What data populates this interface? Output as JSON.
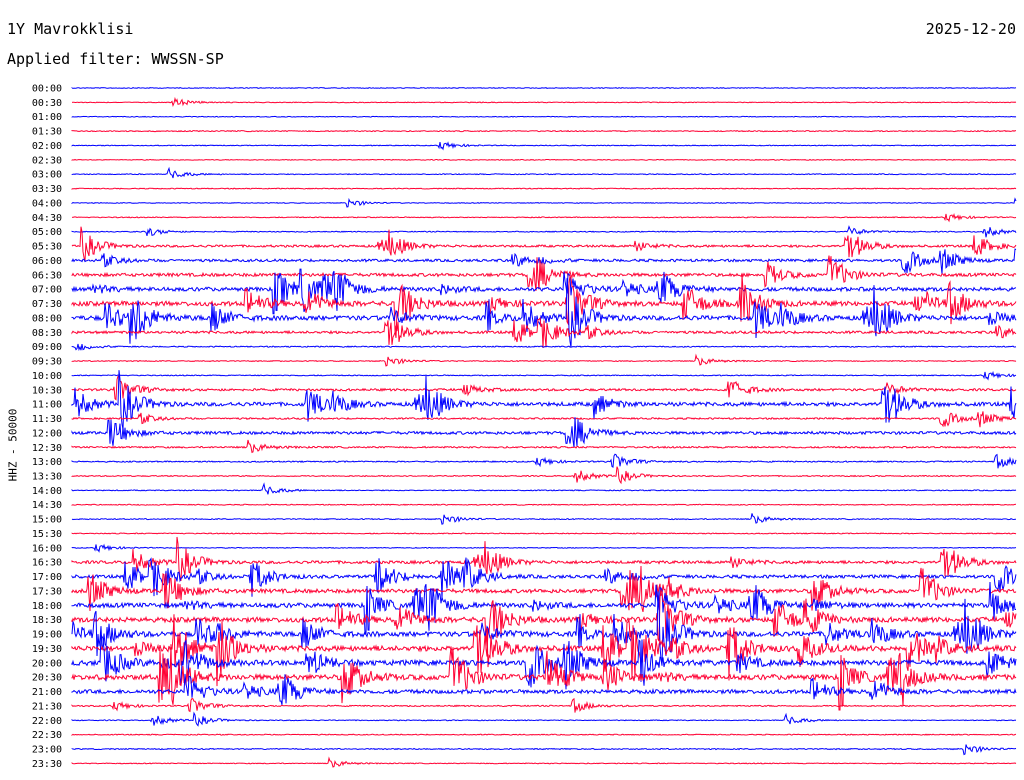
{
  "header": {
    "station": "1Y Mavrokklisi",
    "date": "2025-12-20",
    "filter": "Applied filter: WWSSN-SP"
  },
  "chart_data": {
    "type": "line",
    "title": "1Y Mavrokklisi",
    "subtitle": "Applied filter: WWSSN-SP",
    "ylabel": "HHZ - 50000",
    "xlabel": "",
    "colors": [
      "#0000ff",
      "#ff0033"
    ],
    "grid": false,
    "legend": "none",
    "row_labels": [
      "00:00",
      "00:30",
      "01:00",
      "01:30",
      "02:00",
      "02:30",
      "03:00",
      "03:30",
      "04:00",
      "04:30",
      "05:00",
      "05:30",
      "06:00",
      "06:30",
      "07:00",
      "07:30",
      "08:00",
      "08:30",
      "09:00",
      "09:30",
      "10:00",
      "10:30",
      "11:00",
      "11:30",
      "12:00",
      "12:30",
      "13:00",
      "13:30",
      "14:00",
      "14:30",
      "15:00",
      "15:30",
      "16:00",
      "16:30",
      "17:00",
      "17:30",
      "18:00",
      "18:30",
      "19:00",
      "19:30",
      "20:00",
      "20:30",
      "21:00",
      "21:30",
      "22:00",
      "22:30",
      "23:00",
      "23:30"
    ],
    "row_activity": [
      0.05,
      0.04,
      0.03,
      0.12,
      0.05,
      0.04,
      0.08,
      0.08,
      0.03,
      0.08,
      0.1,
      0.5,
      0.6,
      0.8,
      1.0,
      1.2,
      1.2,
      0.6,
      0.15,
      0.1,
      0.1,
      0.5,
      1.0,
      0.3,
      0.7,
      0.3,
      0.2,
      0.15,
      0.1,
      0.1,
      0.12,
      0.1,
      0.05,
      0.7,
      0.8,
      1.0,
      1.2,
      1.3,
      1.3,
      1.4,
      1.4,
      1.4,
      1.0,
      0.2,
      0.08,
      0.1,
      0.15,
      0.06
    ]
  }
}
